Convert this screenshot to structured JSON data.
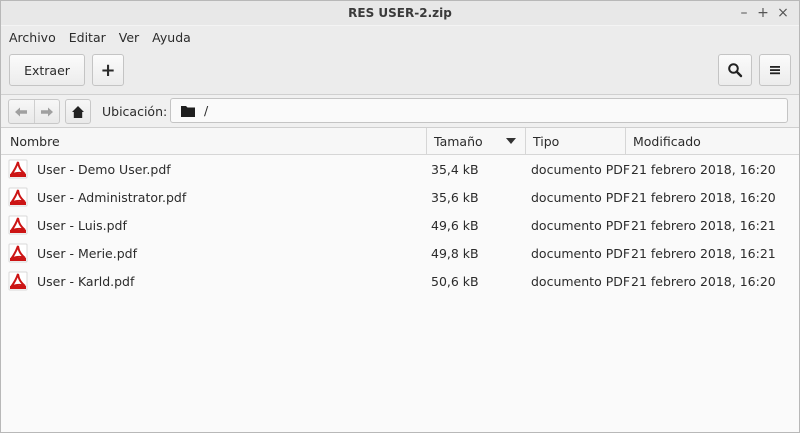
{
  "window": {
    "title": "RES USER-2.zip",
    "minimize_glyph": "–",
    "maximize_glyph": "+",
    "close_glyph": "×"
  },
  "menubar": {
    "items": [
      "Archivo",
      "Editar",
      "Ver",
      "Ayuda"
    ]
  },
  "toolbar": {
    "extract_label": "Extraer",
    "add_label": "+",
    "search_icon": "search-icon",
    "menu_icon": "hamburger-menu-icon"
  },
  "location": {
    "label": "Ubicación:",
    "path": "/"
  },
  "columns": {
    "name": "Nombre",
    "size": "Tamaño",
    "type": "Tipo",
    "modified": "Modificado",
    "sorted_by": "size"
  },
  "files": [
    {
      "name": "User - Demo User.pdf",
      "size": "35,4 kB",
      "type": "documento PDF",
      "modified": "21 febrero 2018, 16:20"
    },
    {
      "name": "User - Administrator.pdf",
      "size": "35,6 kB",
      "type": "documento PDF",
      "modified": "21 febrero 2018, 16:20"
    },
    {
      "name": "User - Luis.pdf",
      "size": "49,6 kB",
      "type": "documento PDF",
      "modified": "21 febrero 2018, 16:21"
    },
    {
      "name": "User - Merie.pdf",
      "size": "49,8 kB",
      "type": "documento PDF",
      "modified": "21 febrero 2018, 16:21"
    },
    {
      "name": "User - Karld.pdf",
      "size": "50,6 kB",
      "type": "documento PDF",
      "modified": "21 febrero 2018, 16:20"
    }
  ],
  "colors": {
    "pdf_icon_red": "#cc1414",
    "window_bg": "#f4f4f4"
  }
}
